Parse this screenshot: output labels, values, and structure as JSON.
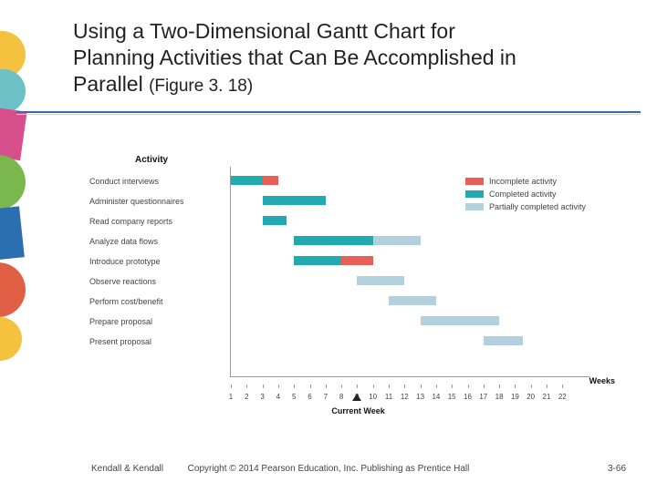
{
  "title": {
    "line1": "Using a Two-Dimensional Gantt Chart for",
    "line2": "Planning Activities that Can Be Accomplished in",
    "line3": "Parallel",
    "figure": "(Figure 3. 18)"
  },
  "footer": {
    "left": "Kendall & Kendall",
    "center": "Copyright © 2014 Pearson Education, Inc. Publishing as Prentice Hall",
    "right": "3-66"
  },
  "chart_data": {
    "type": "bar",
    "title": "Activity",
    "xlabel": "Weeks",
    "ylim": [
      0,
      22.5
    ],
    "x": [
      1,
      2,
      3,
      4,
      5,
      6,
      7,
      8,
      9,
      10,
      11,
      12,
      13,
      14,
      15,
      16,
      17,
      18,
      19,
      20,
      21,
      22
    ],
    "current_week": 9,
    "current_week_label": "Current Week",
    "legend": [
      {
        "name": "Incomplete activity",
        "color": "#e85f58",
        "key": "incomplete"
      },
      {
        "name": "Completed activity",
        "color": "#23aab0",
        "key": "completed"
      },
      {
        "name": "Partially completed activity",
        "color": "#b3d0de",
        "key": "partial"
      }
    ],
    "categories": [
      "Conduct interviews",
      "Administer questionnaires",
      "Read company reports",
      "Analyze data flows",
      "Introduce prototype",
      "Observe reactions",
      "Perform cost/benefit",
      "Prepare proposal",
      "Present proposal"
    ],
    "series": [
      {
        "activity": "Conduct interviews",
        "segments": [
          {
            "start": 1,
            "end": 3,
            "status": "completed"
          },
          {
            "start": 3,
            "end": 4,
            "status": "incomplete"
          }
        ]
      },
      {
        "activity": "Administer questionnaires",
        "segments": [
          {
            "start": 3,
            "end": 7,
            "status": "completed"
          }
        ]
      },
      {
        "activity": "Read company reports",
        "segments": [
          {
            "start": 3,
            "end": 4.5,
            "status": "completed"
          }
        ]
      },
      {
        "activity": "Analyze data flows",
        "segments": [
          {
            "start": 5,
            "end": 10,
            "status": "completed"
          },
          {
            "start": 10,
            "end": 13,
            "status": "partial"
          }
        ]
      },
      {
        "activity": "Introduce prototype",
        "segments": [
          {
            "start": 5,
            "end": 8,
            "status": "completed"
          },
          {
            "start": 8,
            "end": 10,
            "status": "incomplete"
          }
        ]
      },
      {
        "activity": "Observe reactions",
        "segments": [
          {
            "start": 9,
            "end": 12,
            "status": "partial"
          }
        ]
      },
      {
        "activity": "Perform cost/benefit",
        "segments": [
          {
            "start": 11,
            "end": 14,
            "status": "partial"
          }
        ]
      },
      {
        "activity": "Prepare proposal",
        "segments": [
          {
            "start": 13,
            "end": 18,
            "status": "partial"
          }
        ]
      },
      {
        "activity": "Present proposal",
        "segments": [
          {
            "start": 17,
            "end": 19.5,
            "status": "partial"
          }
        ]
      }
    ]
  }
}
